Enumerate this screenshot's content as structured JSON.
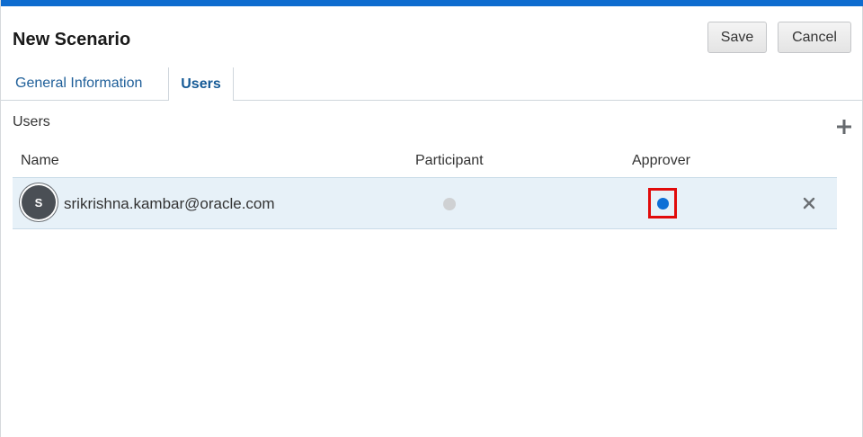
{
  "header": {
    "title": "New Scenario",
    "save_label": "Save",
    "cancel_label": "Cancel"
  },
  "tabs": [
    {
      "label": "General Information",
      "selected": false
    },
    {
      "label": "Users",
      "selected": true
    }
  ],
  "users_section": {
    "label": "Users",
    "add_icon": "plus-icon",
    "columns": [
      "Name",
      "Participant",
      "Approver"
    ],
    "rows": [
      {
        "avatar_initial": "S",
        "name": "srikrishna.kambar@oracle.com",
        "participant": false,
        "approver": true,
        "remove_icon": "close-icon"
      }
    ]
  },
  "colors": {
    "accent_bar": "#0e6ccf",
    "selected_radio": "#0d6fd6",
    "unselected_radio": "#cfd1d3",
    "highlight_box": "#e10b0b",
    "row_background": "#e7f1f8"
  }
}
